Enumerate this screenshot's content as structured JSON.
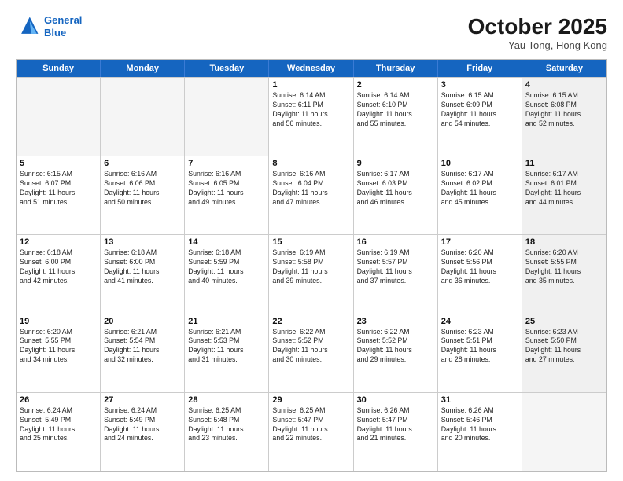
{
  "header": {
    "logo_line1": "General",
    "logo_line2": "Blue",
    "month": "October 2025",
    "location": "Yau Tong, Hong Kong"
  },
  "weekdays": [
    "Sunday",
    "Monday",
    "Tuesday",
    "Wednesday",
    "Thursday",
    "Friday",
    "Saturday"
  ],
  "rows": [
    [
      {
        "day": "",
        "lines": [],
        "shaded": false,
        "empty": true
      },
      {
        "day": "",
        "lines": [],
        "shaded": false,
        "empty": true
      },
      {
        "day": "",
        "lines": [],
        "shaded": false,
        "empty": true
      },
      {
        "day": "1",
        "lines": [
          "Sunrise: 6:14 AM",
          "Sunset: 6:11 PM",
          "Daylight: 11 hours",
          "and 56 minutes."
        ],
        "shaded": false,
        "empty": false
      },
      {
        "day": "2",
        "lines": [
          "Sunrise: 6:14 AM",
          "Sunset: 6:10 PM",
          "Daylight: 11 hours",
          "and 55 minutes."
        ],
        "shaded": false,
        "empty": false
      },
      {
        "day": "3",
        "lines": [
          "Sunrise: 6:15 AM",
          "Sunset: 6:09 PM",
          "Daylight: 11 hours",
          "and 54 minutes."
        ],
        "shaded": false,
        "empty": false
      },
      {
        "day": "4",
        "lines": [
          "Sunrise: 6:15 AM",
          "Sunset: 6:08 PM",
          "Daylight: 11 hours",
          "and 52 minutes."
        ],
        "shaded": true,
        "empty": false
      }
    ],
    [
      {
        "day": "5",
        "lines": [
          "Sunrise: 6:15 AM",
          "Sunset: 6:07 PM",
          "Daylight: 11 hours",
          "and 51 minutes."
        ],
        "shaded": false,
        "empty": false
      },
      {
        "day": "6",
        "lines": [
          "Sunrise: 6:16 AM",
          "Sunset: 6:06 PM",
          "Daylight: 11 hours",
          "and 50 minutes."
        ],
        "shaded": false,
        "empty": false
      },
      {
        "day": "7",
        "lines": [
          "Sunrise: 6:16 AM",
          "Sunset: 6:05 PM",
          "Daylight: 11 hours",
          "and 49 minutes."
        ],
        "shaded": false,
        "empty": false
      },
      {
        "day": "8",
        "lines": [
          "Sunrise: 6:16 AM",
          "Sunset: 6:04 PM",
          "Daylight: 11 hours",
          "and 47 minutes."
        ],
        "shaded": false,
        "empty": false
      },
      {
        "day": "9",
        "lines": [
          "Sunrise: 6:17 AM",
          "Sunset: 6:03 PM",
          "Daylight: 11 hours",
          "and 46 minutes."
        ],
        "shaded": false,
        "empty": false
      },
      {
        "day": "10",
        "lines": [
          "Sunrise: 6:17 AM",
          "Sunset: 6:02 PM",
          "Daylight: 11 hours",
          "and 45 minutes."
        ],
        "shaded": false,
        "empty": false
      },
      {
        "day": "11",
        "lines": [
          "Sunrise: 6:17 AM",
          "Sunset: 6:01 PM",
          "Daylight: 11 hours",
          "and 44 minutes."
        ],
        "shaded": true,
        "empty": false
      }
    ],
    [
      {
        "day": "12",
        "lines": [
          "Sunrise: 6:18 AM",
          "Sunset: 6:00 PM",
          "Daylight: 11 hours",
          "and 42 minutes."
        ],
        "shaded": false,
        "empty": false
      },
      {
        "day": "13",
        "lines": [
          "Sunrise: 6:18 AM",
          "Sunset: 6:00 PM",
          "Daylight: 11 hours",
          "and 41 minutes."
        ],
        "shaded": false,
        "empty": false
      },
      {
        "day": "14",
        "lines": [
          "Sunrise: 6:18 AM",
          "Sunset: 5:59 PM",
          "Daylight: 11 hours",
          "and 40 minutes."
        ],
        "shaded": false,
        "empty": false
      },
      {
        "day": "15",
        "lines": [
          "Sunrise: 6:19 AM",
          "Sunset: 5:58 PM",
          "Daylight: 11 hours",
          "and 39 minutes."
        ],
        "shaded": false,
        "empty": false
      },
      {
        "day": "16",
        "lines": [
          "Sunrise: 6:19 AM",
          "Sunset: 5:57 PM",
          "Daylight: 11 hours",
          "and 37 minutes."
        ],
        "shaded": false,
        "empty": false
      },
      {
        "day": "17",
        "lines": [
          "Sunrise: 6:20 AM",
          "Sunset: 5:56 PM",
          "Daylight: 11 hours",
          "and 36 minutes."
        ],
        "shaded": false,
        "empty": false
      },
      {
        "day": "18",
        "lines": [
          "Sunrise: 6:20 AM",
          "Sunset: 5:55 PM",
          "Daylight: 11 hours",
          "and 35 minutes."
        ],
        "shaded": true,
        "empty": false
      }
    ],
    [
      {
        "day": "19",
        "lines": [
          "Sunrise: 6:20 AM",
          "Sunset: 5:55 PM",
          "Daylight: 11 hours",
          "and 34 minutes."
        ],
        "shaded": false,
        "empty": false
      },
      {
        "day": "20",
        "lines": [
          "Sunrise: 6:21 AM",
          "Sunset: 5:54 PM",
          "Daylight: 11 hours",
          "and 32 minutes."
        ],
        "shaded": false,
        "empty": false
      },
      {
        "day": "21",
        "lines": [
          "Sunrise: 6:21 AM",
          "Sunset: 5:53 PM",
          "Daylight: 11 hours",
          "and 31 minutes."
        ],
        "shaded": false,
        "empty": false
      },
      {
        "day": "22",
        "lines": [
          "Sunrise: 6:22 AM",
          "Sunset: 5:52 PM",
          "Daylight: 11 hours",
          "and 30 minutes."
        ],
        "shaded": false,
        "empty": false
      },
      {
        "day": "23",
        "lines": [
          "Sunrise: 6:22 AM",
          "Sunset: 5:52 PM",
          "Daylight: 11 hours",
          "and 29 minutes."
        ],
        "shaded": false,
        "empty": false
      },
      {
        "day": "24",
        "lines": [
          "Sunrise: 6:23 AM",
          "Sunset: 5:51 PM",
          "Daylight: 11 hours",
          "and 28 minutes."
        ],
        "shaded": false,
        "empty": false
      },
      {
        "day": "25",
        "lines": [
          "Sunrise: 6:23 AM",
          "Sunset: 5:50 PM",
          "Daylight: 11 hours",
          "and 27 minutes."
        ],
        "shaded": true,
        "empty": false
      }
    ],
    [
      {
        "day": "26",
        "lines": [
          "Sunrise: 6:24 AM",
          "Sunset: 5:49 PM",
          "Daylight: 11 hours",
          "and 25 minutes."
        ],
        "shaded": false,
        "empty": false
      },
      {
        "day": "27",
        "lines": [
          "Sunrise: 6:24 AM",
          "Sunset: 5:49 PM",
          "Daylight: 11 hours",
          "and 24 minutes."
        ],
        "shaded": false,
        "empty": false
      },
      {
        "day": "28",
        "lines": [
          "Sunrise: 6:25 AM",
          "Sunset: 5:48 PM",
          "Daylight: 11 hours",
          "and 23 minutes."
        ],
        "shaded": false,
        "empty": false
      },
      {
        "day": "29",
        "lines": [
          "Sunrise: 6:25 AM",
          "Sunset: 5:47 PM",
          "Daylight: 11 hours",
          "and 22 minutes."
        ],
        "shaded": false,
        "empty": false
      },
      {
        "day": "30",
        "lines": [
          "Sunrise: 6:26 AM",
          "Sunset: 5:47 PM",
          "Daylight: 11 hours",
          "and 21 minutes."
        ],
        "shaded": false,
        "empty": false
      },
      {
        "day": "31",
        "lines": [
          "Sunrise: 6:26 AM",
          "Sunset: 5:46 PM",
          "Daylight: 11 hours",
          "and 20 minutes."
        ],
        "shaded": false,
        "empty": false
      },
      {
        "day": "",
        "lines": [],
        "shaded": true,
        "empty": true
      }
    ]
  ]
}
